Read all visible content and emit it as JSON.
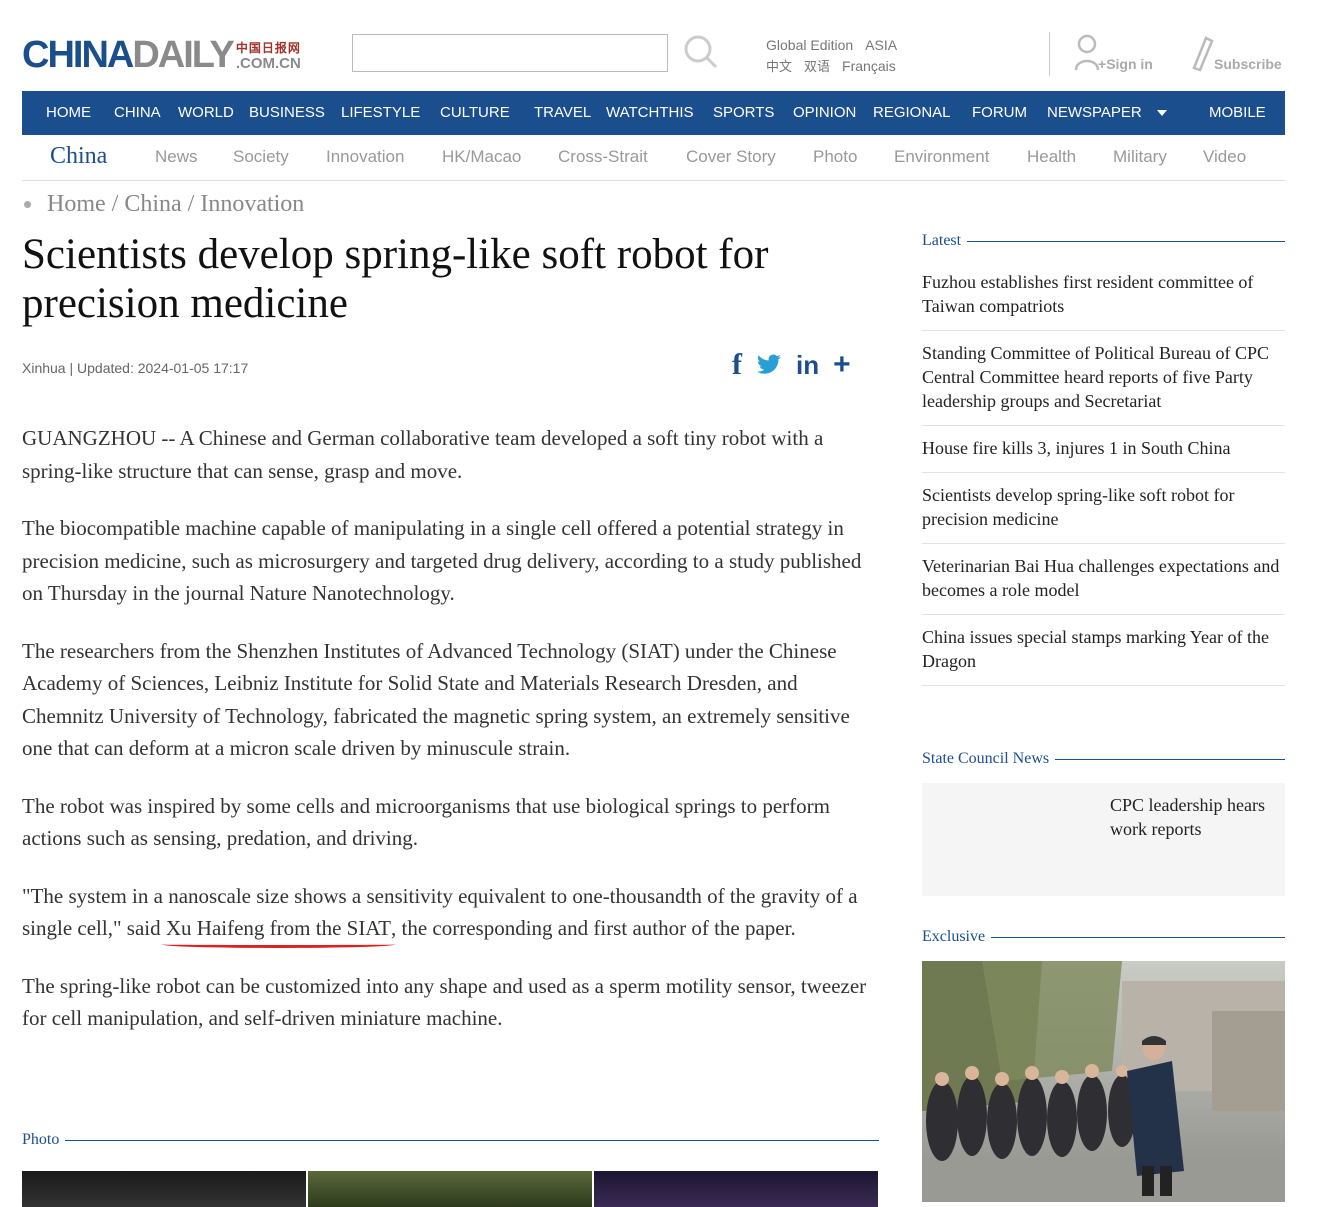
{
  "header": {
    "logo_main_a": "CHINA",
    "logo_main_b": "DAILY",
    "logo_cn": "中国日报网",
    "logo_com": ".COM.CN",
    "search_placeholder": "",
    "edition_global": "Global Edition",
    "edition_asia": "ASIA",
    "lang_zh": "中文",
    "lang_shuangyu": "双语",
    "lang_fr": "Français",
    "sign_in": "Sign in",
    "subscribe": "Subscribe"
  },
  "nav": {
    "items": [
      "HOME",
      "CHINA",
      "WORLD",
      "BUSINESS",
      "LIFESTYLE",
      "CULTURE",
      "TRAVEL",
      "WATCHTHIS",
      "SPORTS",
      "OPINION",
      "REGIONAL",
      "FORUM",
      "NEWSPAPER",
      "MOBILE"
    ]
  },
  "subnav": {
    "title": "China",
    "items": [
      "News",
      "Society",
      "Innovation",
      "HK/Macao",
      "Cross-Strait",
      "Cover Story",
      "Photo",
      "Environment",
      "Health",
      "Military",
      "Video"
    ]
  },
  "breadcrumb": {
    "home": "Home",
    "sep": " / ",
    "china": "China",
    "innovation": "Innovation"
  },
  "article": {
    "title": "Scientists develop spring-like soft robot for precision medicine",
    "meta": "Xinhua | Updated: 2024-01-05 17:17",
    "share": {
      "facebook": "f",
      "linkedin": "in",
      "more": "+"
    },
    "p1": "GUANGZHOU -- A Chinese and German collaborative team developed a soft tiny robot with a spring-like structure that can sense, grasp and move.",
    "p2": "The biocompatible machine capable of manipulating in a single cell offered a potential strategy in precision medicine, such as microsurgery and targeted drug delivery, according to a study published on Thursday in the journal Nature Nanotechnology.",
    "p3": "The researchers from the Shenzhen Institutes of Advanced Technology (SIAT) under the Chinese Academy of Sciences, Leibniz Institute for Solid State and Materials Research Dresden, and Chemnitz University of Technology, fabricated the magnetic spring system, an extremely sensitive one that can deform at a micron scale driven by minuscule strain.",
    "p4": "The robot was inspired by some cells and microorganisms that use biological springs to perform actions such as sensing, predation, and driving.",
    "p5_a": "\"The system in a nanoscale size shows a sensitivity equivalent to one-thousandth of the gravity of a single cell,\" said ",
    "p5_b": "Xu Haifeng from the SIAT",
    "p5_c": ", the corresponding and first author of the paper.",
    "p6": "The spring-like robot can be customized into any shape and used as a sperm motility sensor, tweezer for cell manipulation, and self-driven miniature machine."
  },
  "photo_section": {
    "label": "Photo"
  },
  "sidebar": {
    "latest_label": "Latest",
    "latest": [
      "Fuzhou establishes first resident committee of Taiwan compatriots",
      "Standing Committee of Political Bureau of CPC Central Committee heard reports of five Party leadership groups and Secretariat",
      "House fire kills 3, injures 1 in South China",
      "Scientists develop spring-like soft robot for precision medicine",
      "Veterinarian Bai Hua challenges expectations and becomes a role model",
      "China issues special stamps marking Year of the Dragon"
    ],
    "state_label": "State Council News",
    "state_item": "CPC leadership hears work reports",
    "exclusive_label": "Exclusive"
  },
  "colors": {
    "brand_blue": "#1a4e8d",
    "underline_red": "#e02020"
  }
}
